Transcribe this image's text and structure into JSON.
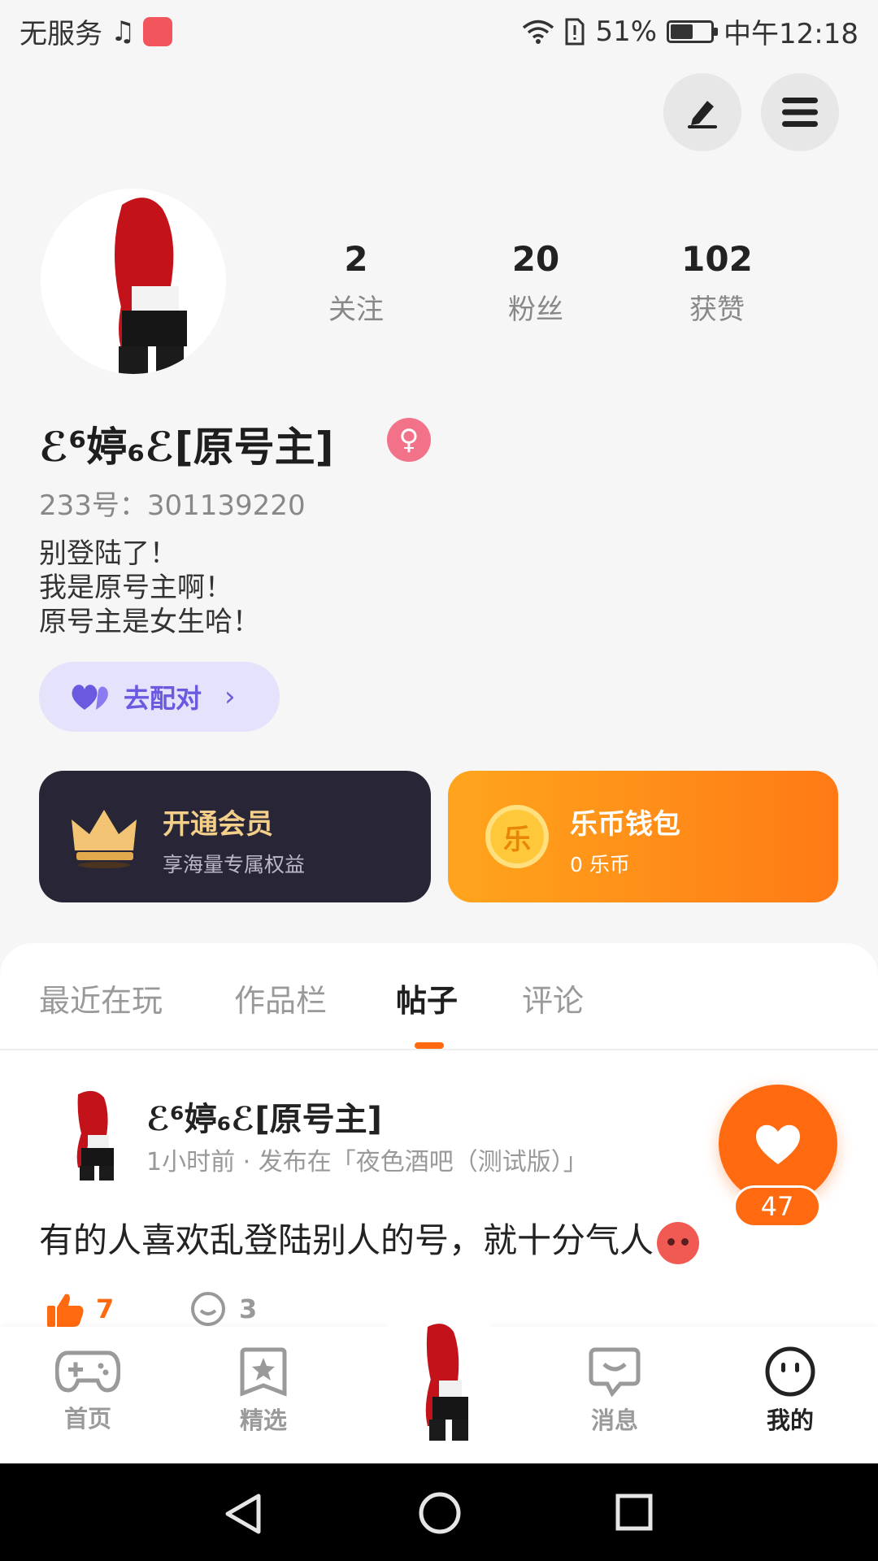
{
  "status_bar": {
    "carrier": "无服务",
    "battery_percent": "51%",
    "time": "中午12:18",
    "battery_level": 0.51
  },
  "profile": {
    "stats": [
      {
        "value": "2",
        "label": "关注"
      },
      {
        "value": "20",
        "label": "粉丝"
      },
      {
        "value": "102",
        "label": "获赞"
      }
    ],
    "username": "ℰ⁶婷₆ℰ[原号主]",
    "uid": "233号：301139220",
    "bio": [
      "别登陆了！",
      "我是原号主啊！",
      "原号主是女生哈！"
    ],
    "match_button": "去配对"
  },
  "cards": {
    "vip_title": "开通会员",
    "vip_sub": "享海量专属权益",
    "wallet_title": "乐币钱包",
    "wallet_sub": "0 乐币",
    "wallet_coin": "乐"
  },
  "tabs": [
    {
      "label": "最近在玩",
      "active": false
    },
    {
      "label": "作品栏",
      "active": false
    },
    {
      "label": "帖子",
      "active": true
    },
    {
      "label": "评论",
      "active": false
    }
  ],
  "post": {
    "author": "ℰ⁶婷₆ℰ[原号主]",
    "meta": "1小时前 · 发布在「夜色酒吧（测试版）」",
    "text": "有的人喜欢乱登陆别人的号，就十分气人",
    "likes": "7",
    "comments": "3",
    "float_like_count": "47"
  },
  "bottom_nav": [
    {
      "label": "首页",
      "icon": "gamepad-icon",
      "active": false
    },
    {
      "label": "精选",
      "icon": "star-icon",
      "active": false
    },
    {
      "label": "消息",
      "icon": "chat-icon",
      "active": false
    },
    {
      "label": "我的",
      "icon": "face-icon",
      "active": true
    }
  ],
  "colors": {
    "accent": "#ff6a10",
    "match_purple": "#6a5ae0",
    "vip_bg": "#282536",
    "vip_gold": "#f3cf8a",
    "gender_pink": "#f2728a"
  }
}
